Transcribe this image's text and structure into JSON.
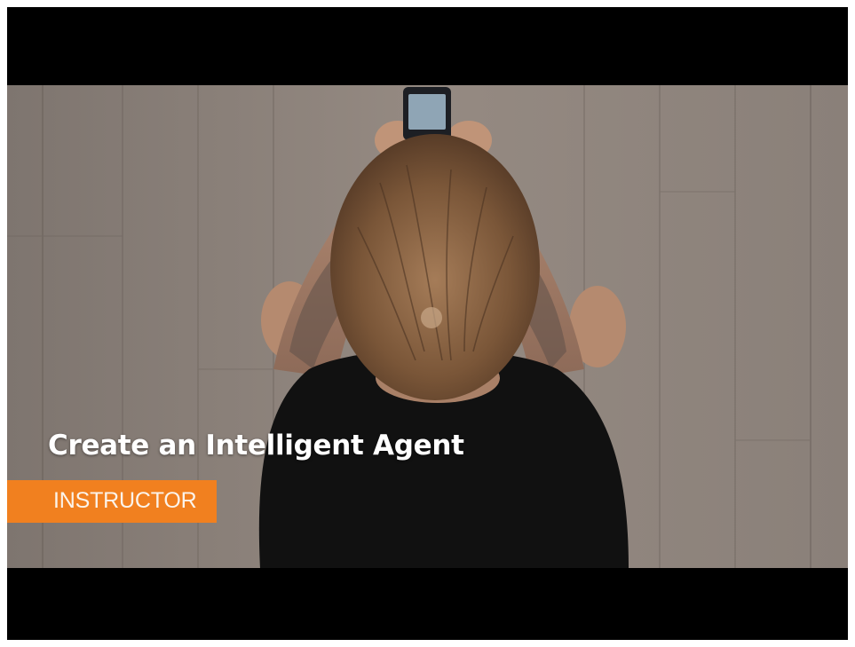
{
  "video": {
    "title_overlay": "Create an Intelligent Agent",
    "role_badge": "INSTRUCTOR"
  },
  "colors": {
    "letterbox": "#000000",
    "badge_background": "#f1801f",
    "title_text": "#ffffff",
    "floor_wood": "#8a8079",
    "shirt": "#111111",
    "hair": "#6b4a33"
  }
}
